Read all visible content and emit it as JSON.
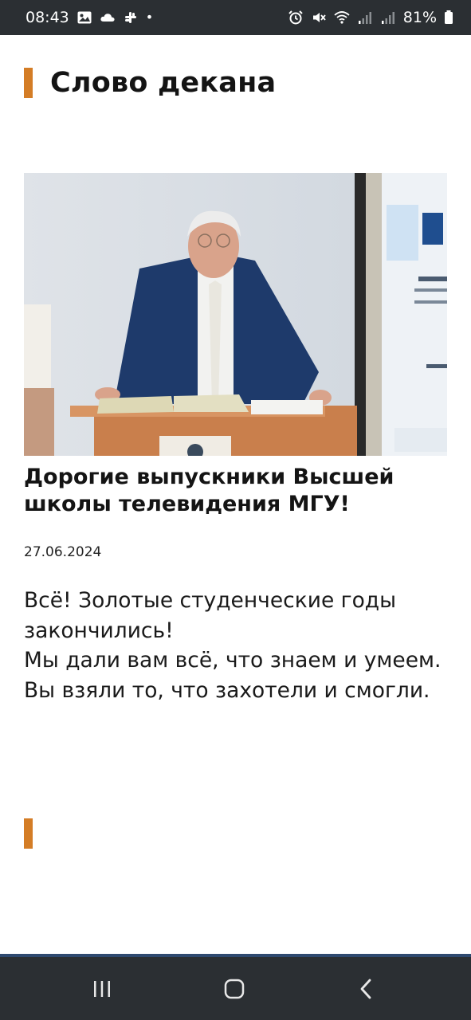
{
  "status_bar": {
    "time": "08:43",
    "left_icons": [
      "image-icon",
      "cloud-icon",
      "slack-icon"
    ],
    "dot": "•",
    "right_icons": [
      "alarm-icon",
      "mute-icon",
      "wifi-icon",
      "signal-icon",
      "signal-icon"
    ],
    "battery": "81%"
  },
  "page": {
    "section_title": "Слово декана",
    "photo_alt": "",
    "article": {
      "title": "Дорогие выпускники Высшей школы телевидения МГУ!",
      "date": "27.06.2024",
      "paragraphs": [
        "Всё! Золотые студенческие годы закончились!",
        "Мы дали вам всё, что знаем и умеем.",
        "Вы взяли то, что захотели и смогли."
      ]
    }
  },
  "nav_bar": {
    "buttons": [
      "recents-icon",
      "home-icon",
      "back-icon"
    ]
  },
  "colors": {
    "accent": "#d47d26",
    "status_bar_bg": "#2b2f33",
    "nav_bar_bg": "#2b2f33",
    "text": "#141414"
  }
}
